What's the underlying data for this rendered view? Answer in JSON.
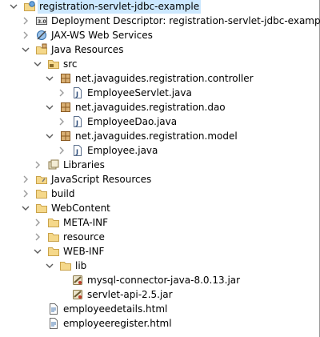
{
  "project_explorer": {
    "items": [
      {
        "label": "registration-servlet-jdbc-example",
        "depth": 0,
        "toggle": "open",
        "icon": "web-project-icon",
        "selected": true
      },
      {
        "label": "Deployment Descriptor: registration-servlet-jdbc-example",
        "depth": 1,
        "toggle": "closed",
        "icon": "deployment-descriptor-icon"
      },
      {
        "label": "JAX-WS Web Services",
        "depth": 1,
        "toggle": "closed",
        "icon": "web-services-icon"
      },
      {
        "label": "Java Resources",
        "depth": 1,
        "toggle": "open",
        "icon": "java-resources-icon"
      },
      {
        "label": "src",
        "depth": 2,
        "toggle": "open",
        "icon": "source-folder-icon"
      },
      {
        "label": "net.javaguides.registration.controller",
        "depth": 3,
        "toggle": "open",
        "icon": "package-icon"
      },
      {
        "label": "EmployeeServlet.java",
        "depth": 4,
        "toggle": "closed",
        "icon": "java-file-icon"
      },
      {
        "label": "net.javaguides.registration.dao",
        "depth": 3,
        "toggle": "open",
        "icon": "package-icon"
      },
      {
        "label": "EmployeeDao.java",
        "depth": 4,
        "toggle": "closed",
        "icon": "java-file-icon"
      },
      {
        "label": "net.javaguides.registration.model",
        "depth": 3,
        "toggle": "open",
        "icon": "package-icon"
      },
      {
        "label": "Employee.java",
        "depth": 4,
        "toggle": "closed",
        "icon": "java-file-icon"
      },
      {
        "label": "Libraries",
        "depth": 2,
        "toggle": "closed",
        "icon": "libraries-icon"
      },
      {
        "label": "JavaScript Resources",
        "depth": 1,
        "toggle": "closed",
        "icon": "javascript-resources-icon"
      },
      {
        "label": "build",
        "depth": 1,
        "toggle": "closed",
        "icon": "folder-icon"
      },
      {
        "label": "WebContent",
        "depth": 1,
        "toggle": "open",
        "icon": "folder-icon"
      },
      {
        "label": "META-INF",
        "depth": 2,
        "toggle": "closed",
        "icon": "folder-icon"
      },
      {
        "label": "resource",
        "depth": 2,
        "toggle": "closed",
        "icon": "folder-icon"
      },
      {
        "label": "WEB-INF",
        "depth": 2,
        "toggle": "open",
        "icon": "folder-icon"
      },
      {
        "label": "lib",
        "depth": 3,
        "toggle": "open",
        "icon": "folder-icon"
      },
      {
        "label": "mysql-connector-java-8.0.13.jar",
        "depth": 4,
        "toggle": "none",
        "icon": "jar-file-icon"
      },
      {
        "label": "servlet-api-2.5.jar",
        "depth": 4,
        "toggle": "none",
        "icon": "jar-file-icon"
      },
      {
        "label": "employeedetails.html",
        "depth": 2,
        "toggle": "none",
        "icon": "html-file-icon"
      },
      {
        "label": "employeeregister.html",
        "depth": 2,
        "toggle": "none",
        "icon": "html-file-icon"
      }
    ]
  }
}
